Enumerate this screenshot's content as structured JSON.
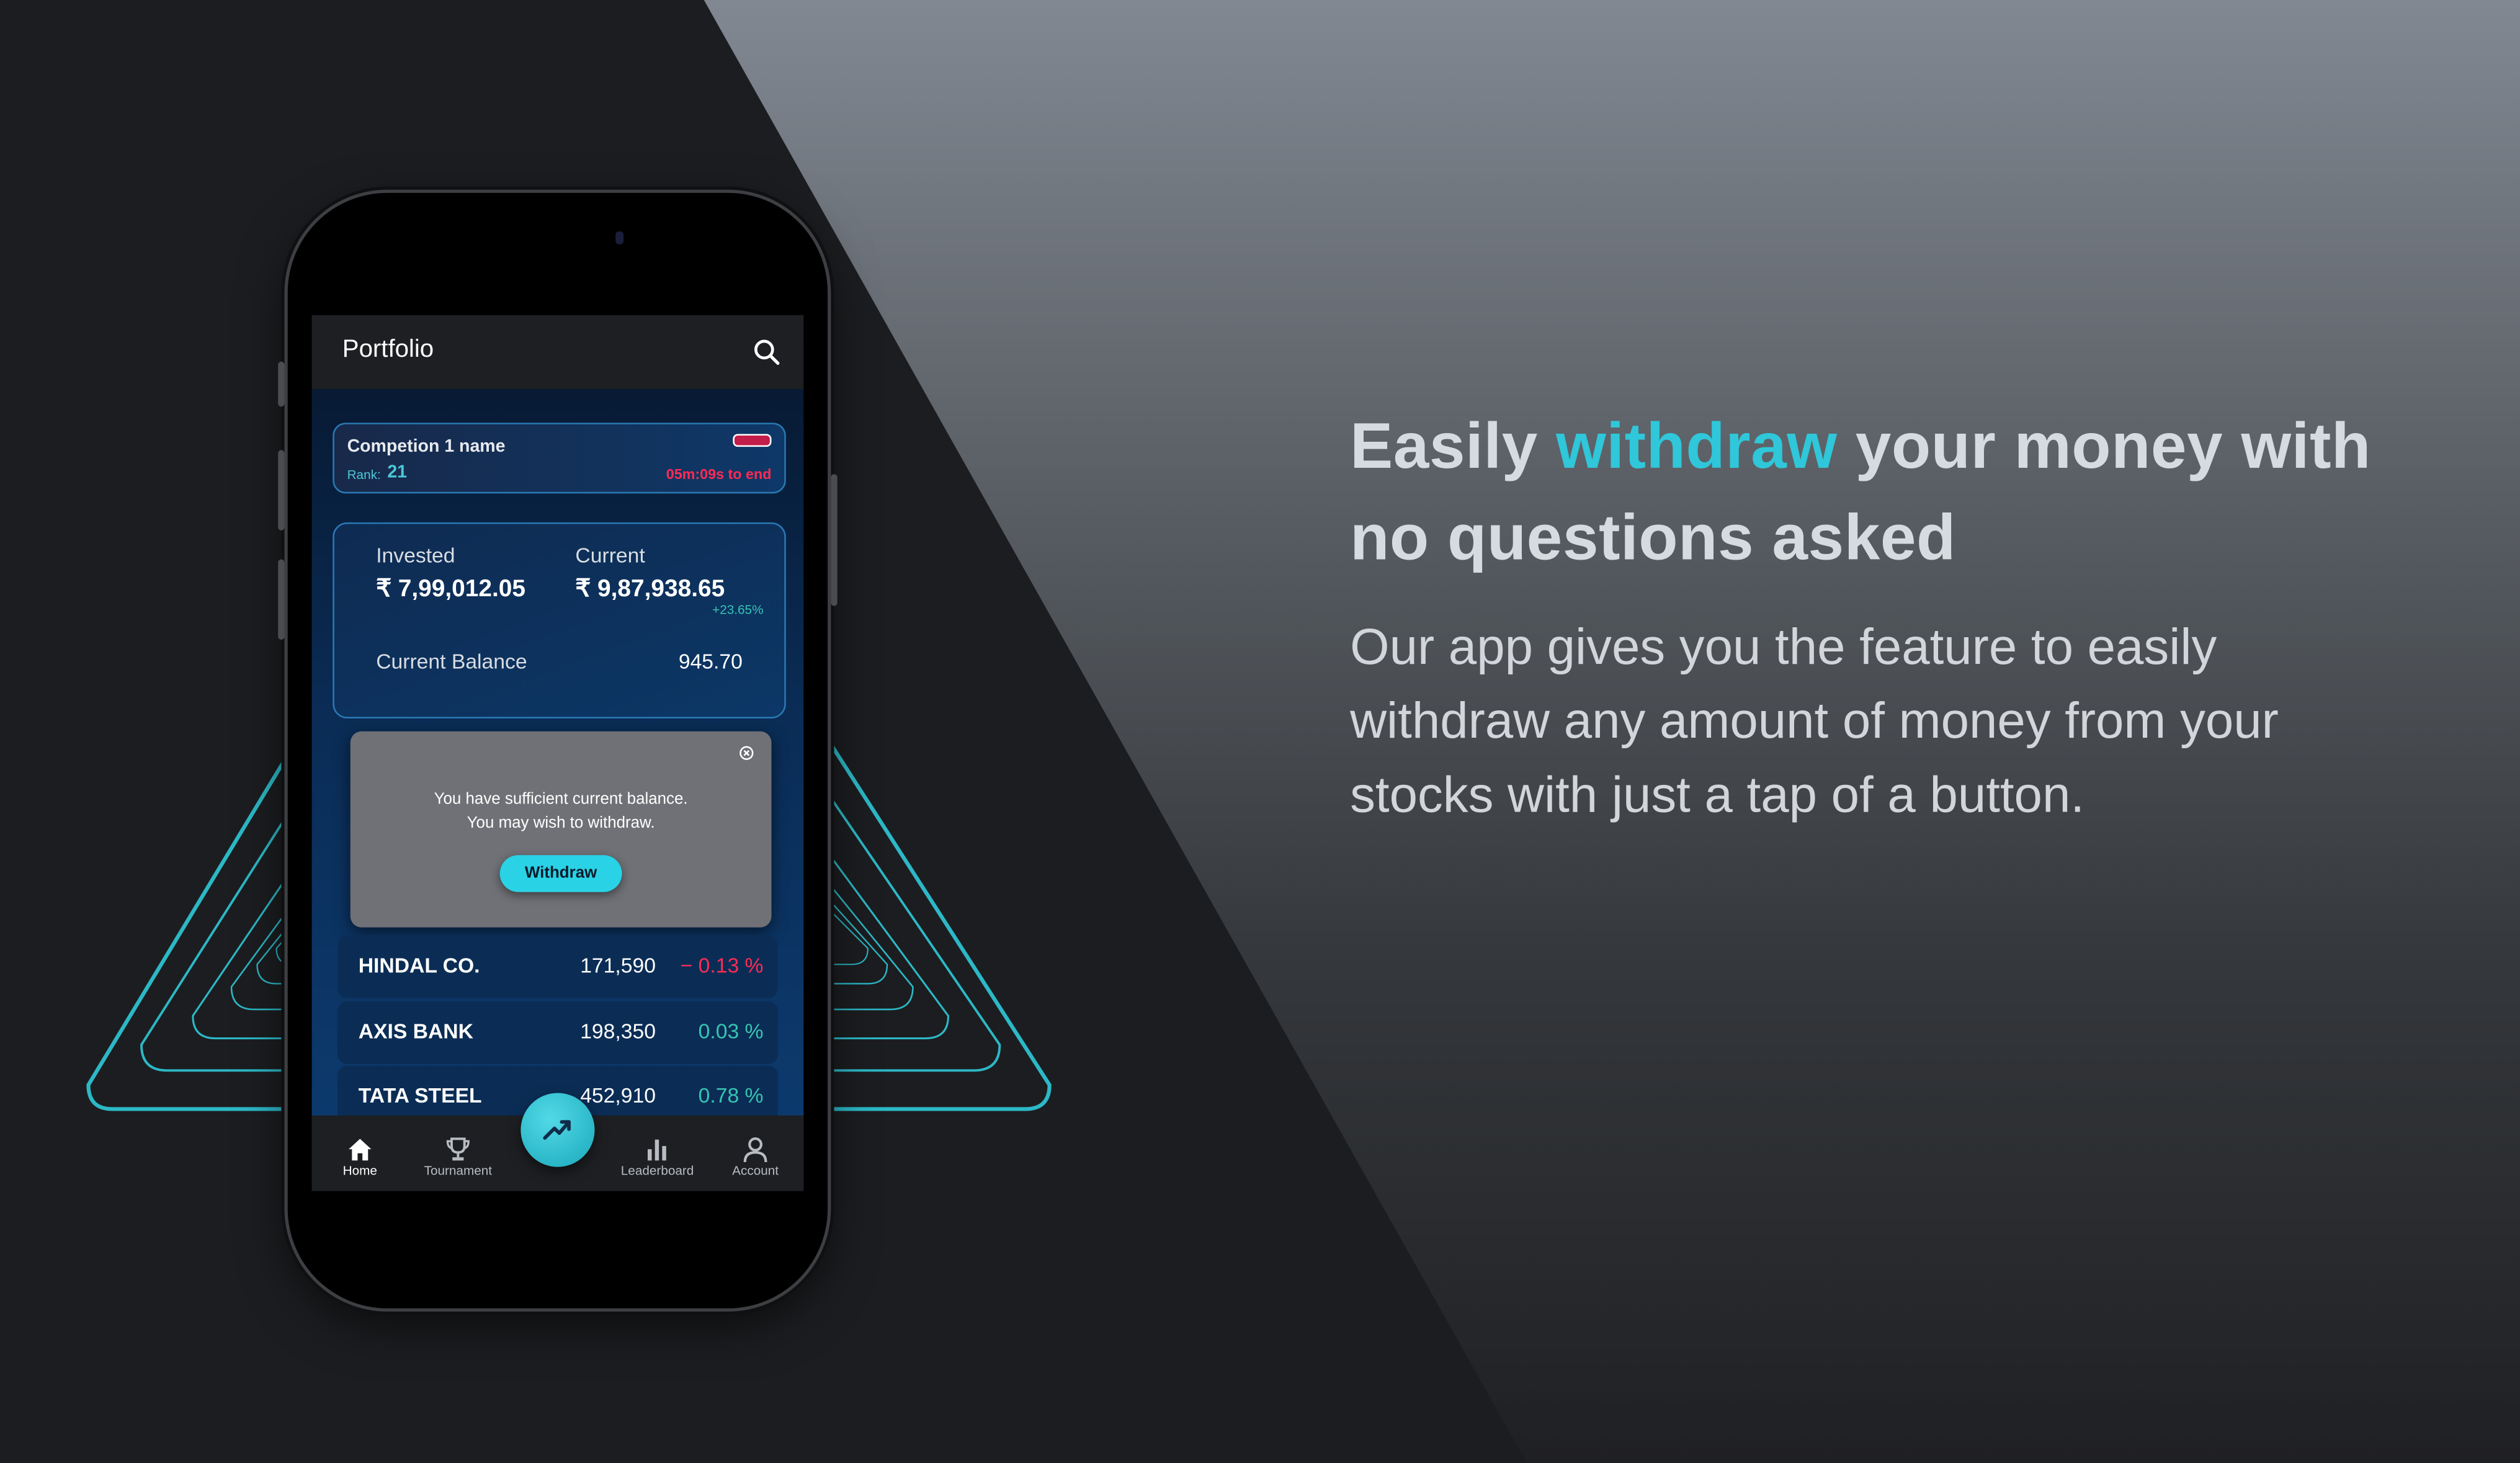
{
  "marketing": {
    "headline_before": "Easily ",
    "headline_highlight": "withdraw",
    "headline_after": " your money with no questions asked",
    "description": "Our app gives you the feature to easily withdraw any amount of money from your stocks with just a tap of a button."
  },
  "app": {
    "title": "Portfolio",
    "competition": {
      "name": "Competion 1 name",
      "rank_label": "Rank:",
      "rank_value": "21",
      "countdown": "05m:09s to end"
    },
    "portfolio": {
      "invested_label": "Invested",
      "invested_value": "₹ 7,99,012.05",
      "current_label": "Current",
      "current_value": "₹ 9,87,938.65",
      "change_percent": "+23.65%",
      "balance_label": "Current Balance",
      "balance_value": "945.70"
    },
    "dialog": {
      "line1": "You have sufficient current balance.",
      "line2": "You may wish to withdraw.",
      "button_label": "Withdraw"
    },
    "stocks": [
      {
        "name": "HINDAL CO.",
        "price": "171,590",
        "change": "− 0.13 %",
        "direction": "down"
      },
      {
        "name": "AXIS BANK",
        "price": "198,350",
        "change": "0.03 %",
        "direction": "up"
      },
      {
        "name": "TATA STEEL",
        "price": "452,910",
        "change": "0.78 %",
        "direction": "up"
      }
    ],
    "nav": {
      "home": "Home",
      "tournament": "Tournament",
      "leaderboard": "Leaderboard",
      "account": "Account"
    }
  },
  "colors": {
    "accent": "#2fc7d9",
    "positive": "#37c4b4",
    "negative": "#ff2b55",
    "background_dark": "#1c1d20",
    "dialog_bg": "#6f7176"
  },
  "icons": [
    "search-icon",
    "close-icon",
    "home-icon",
    "trophy-icon",
    "trend-up-icon",
    "bar-chart-icon",
    "user-icon"
  ]
}
